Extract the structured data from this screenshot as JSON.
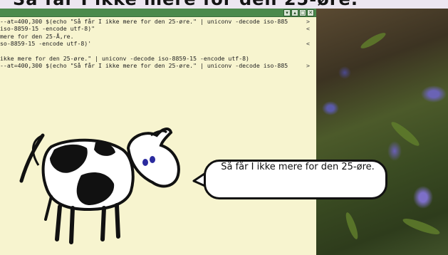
{
  "banner": {
    "text": "Så får I ikke mere for den 25-øre."
  },
  "terminal": {
    "lines": [
      "--at=400,300 $(echo \"Så får I ikke mere for den 25-øre.\" | uniconv -decode iso-885",
      "iso-8859-15 -encode utf-8)\"",
      "mere for den 25-Å,re.",
      "so-8859-15 -encode utf-8)'",
      "",
      "ikke mere for den 25-øre.\" | uniconv -decode iso-8859-15 -encode utf-8)",
      "--at=400,300 $(echo \"Så får I ikke mere for den 25-øre.\" | uniconv -decode iso-885"
    ],
    "line_markers": [
      ">",
      "<",
      "",
      "<",
      "",
      "",
      ">"
    ],
    "window_buttons": [
      "▾",
      "▴",
      "□",
      "✕"
    ]
  },
  "speech": {
    "text": "Så får I ikke mere for den 25-øre."
  },
  "colors": {
    "terminal_bg": "#f7f4cf",
    "titlebar": "#4b8a4c",
    "text": "#222222"
  }
}
